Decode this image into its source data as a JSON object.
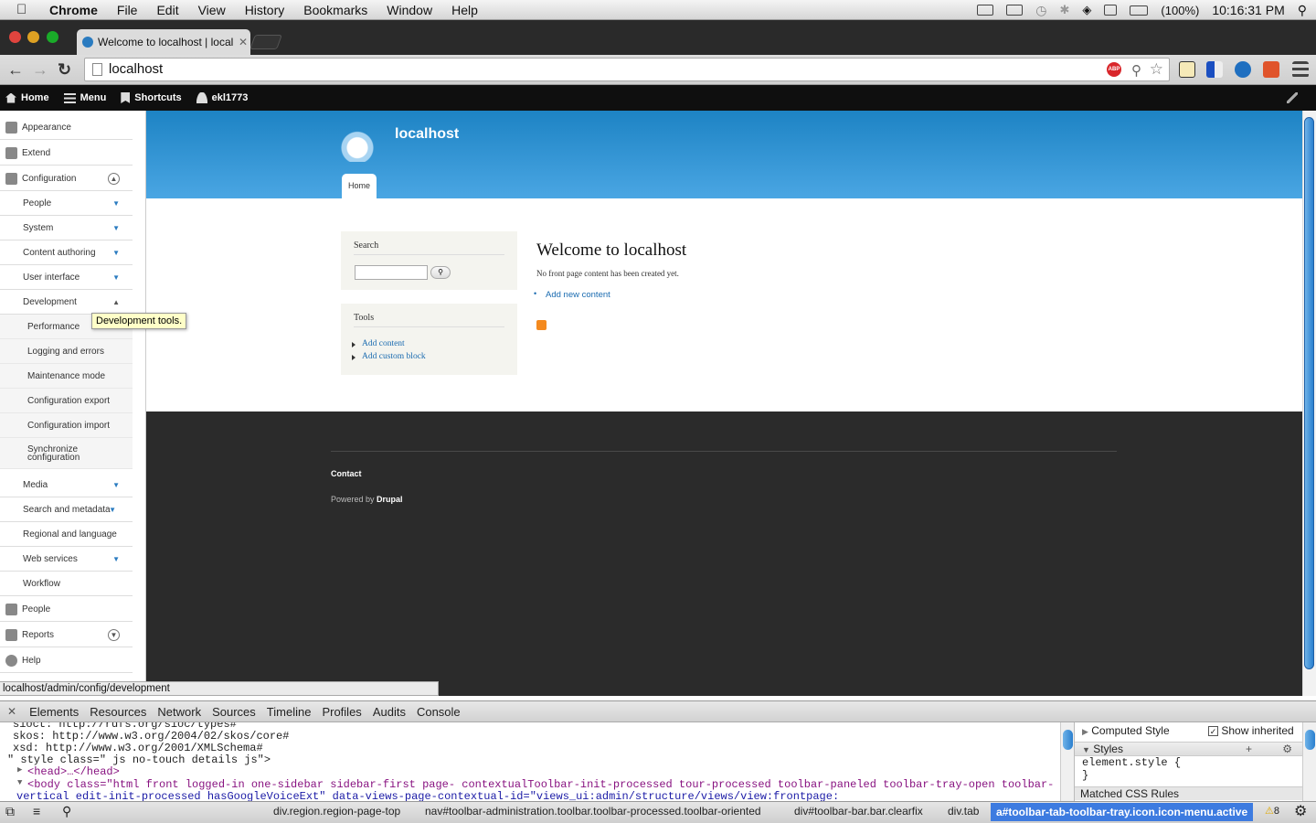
{
  "menubar": {
    "app": "Chrome",
    "items": [
      "File",
      "Edit",
      "View",
      "History",
      "Bookmarks",
      "Window",
      "Help"
    ],
    "battery": "(100%)",
    "clock": "10:16:31 PM"
  },
  "browser": {
    "tab_title": "Welcome to localhost | localhost",
    "url": "localhost"
  },
  "toolbar": {
    "home": "Home",
    "menu": "Menu",
    "shortcuts": "Shortcuts",
    "user": "ekl1773"
  },
  "sidebar": {
    "top": [
      {
        "label": "Appearance"
      },
      {
        "label": "Extend"
      },
      {
        "label": "Configuration"
      }
    ],
    "config_items": [
      {
        "label": "People"
      },
      {
        "label": "System"
      },
      {
        "label": "Content authoring"
      },
      {
        "label": "User interface"
      },
      {
        "label": "Development"
      }
    ],
    "dev_items": [
      {
        "label": "Performance"
      },
      {
        "label": "Logging and errors"
      },
      {
        "label": "Maintenance mode"
      },
      {
        "label": "Configuration export"
      },
      {
        "label": "Configuration import"
      },
      {
        "label": "Synchronize configuration"
      }
    ],
    "config_items2": [
      {
        "label": "Media"
      },
      {
        "label": "Search and metadata"
      },
      {
        "label": "Regional and language"
      },
      {
        "label": "Web services"
      },
      {
        "label": "Workflow"
      }
    ],
    "bottom": [
      {
        "label": "People"
      },
      {
        "label": "Reports"
      },
      {
        "label": "Help"
      }
    ],
    "tooltip": "Development tools."
  },
  "site": {
    "name": "localhost",
    "home_tab": "Home"
  },
  "search_block": {
    "title": "Search"
  },
  "tools_block": {
    "title": "Tools",
    "links": [
      "Add content",
      "Add custom block"
    ]
  },
  "main": {
    "title": "Welcome to localhost",
    "message": "No front page content has been created yet.",
    "add_link": "Add new content"
  },
  "footer": {
    "contact": "Contact",
    "powered_prefix": "Powered by ",
    "powered_link": "Drupal"
  },
  "status_url": "localhost/admin/config/development",
  "devtools": {
    "tabs": [
      "Elements",
      "Resources",
      "Network",
      "Sources",
      "Timeline",
      "Profiles",
      "Audits",
      "Console"
    ],
    "lines": [
      "sioct: http://rdfs.org/sioc/types#",
      "skos: http://www.w3.org/2004/02/skos/core#",
      "xsd: http://www.w3.org/2001/XMLSchema#",
      "\" style class=\" js no-touch details js\">",
      "<head>…</head>",
      "<body class=\"html front logged-in one-sidebar sidebar-first page- contextualToolbar-init-processed tour-processed toolbar-paneled toolbar-tray-open toolbar-",
      "vertical edit-init-processed hasGoogleVoiceExt\" data-views-page-contextual-id=\"views_ui:admin/structure/views/view:frontpage:"
    ],
    "styles": {
      "computed": "Computed Style",
      "show_inherited": "Show inherited",
      "styles_title": "Styles",
      "element_style": "element.style {",
      "close_brace": "}",
      "matched": "Matched CSS Rules"
    },
    "breadcrumbs": [
      "div.region.region-page-top",
      "nav#toolbar-administration.toolbar.toolbar-processed.toolbar-oriented",
      "div#toolbar-bar.bar.clearfix",
      "div.tab",
      "a#toolbar-tab-toolbar-tray.icon.icon-menu.active"
    ],
    "warnings": "8"
  },
  "colors": {
    "accent": "#1d83c4",
    "toolbar": "#0f0f0f",
    "footer": "#2b2b2b",
    "link": "#1a6bb0",
    "selection": "#3d7be0"
  }
}
